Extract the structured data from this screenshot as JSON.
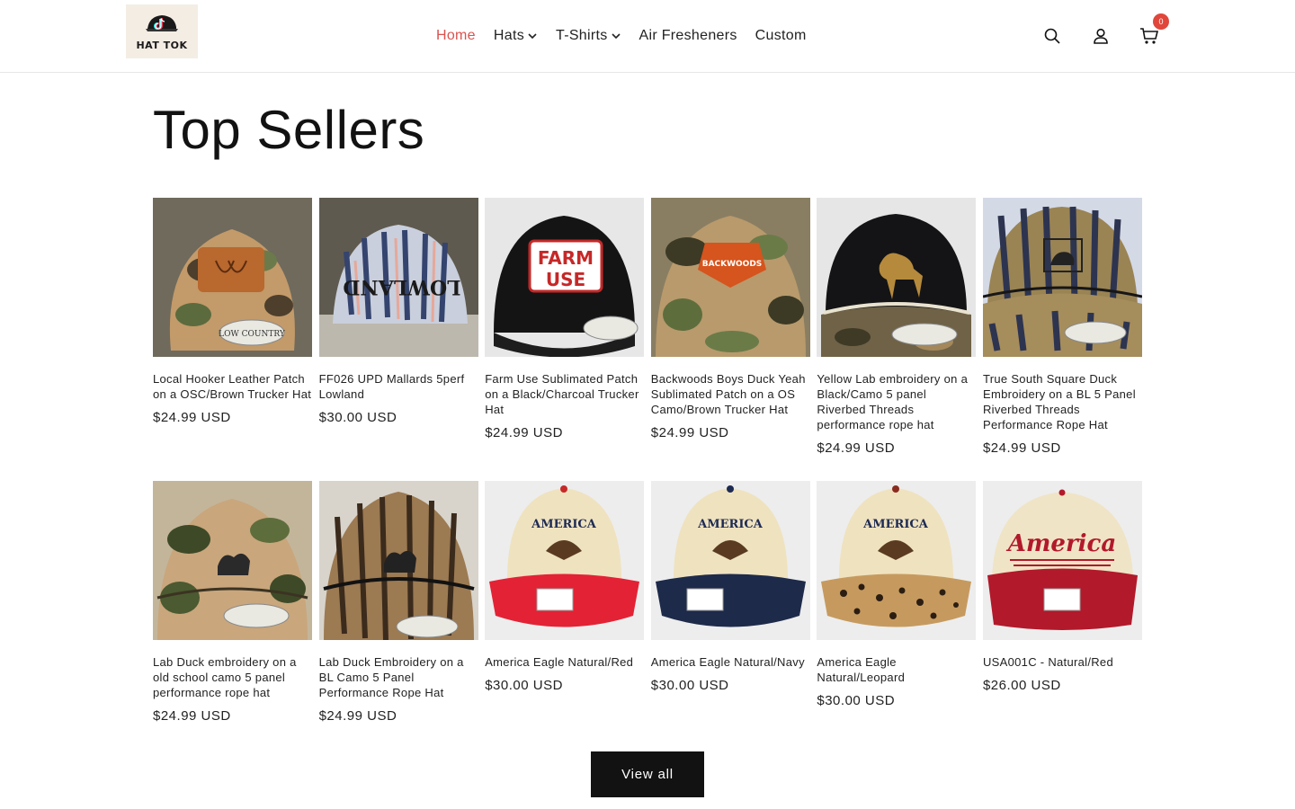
{
  "brand": {
    "name": "HAT TOK"
  },
  "nav": {
    "items": [
      {
        "label": "Home",
        "active": true,
        "dropdown": false
      },
      {
        "label": "Hats",
        "active": false,
        "dropdown": true
      },
      {
        "label": "T-Shirts",
        "active": false,
        "dropdown": true
      },
      {
        "label": "Air Fresheners",
        "active": false,
        "dropdown": false
      },
      {
        "label": "Custom",
        "active": false,
        "dropdown": false
      }
    ]
  },
  "header_icons": {
    "search": "search-icon",
    "account": "account-icon",
    "cart": "cart-icon",
    "cart_count": "0"
  },
  "colors": {
    "accent": "#d9534f",
    "badge": "#e0463a",
    "button": "#121212"
  },
  "section": {
    "title": "Top Sellers",
    "view_all": "View all"
  },
  "products": [
    {
      "title": "Local Hooker Leather Patch on a OSC/Brown Trucker Hat",
      "price": "$24.99 USD",
      "art": "camo-leather"
    },
    {
      "title": "FF026 UPD Mallards 5perf Lowland",
      "price": "$30.00 USD",
      "art": "lowland"
    },
    {
      "title": "Farm Use Sublimated Patch on a Black/Charcoal Trucker Hat",
      "price": "$24.99 USD",
      "art": "farm-use"
    },
    {
      "title": "Backwoods Boys Duck Yeah Sublimated Patch on a OS Camo/Brown Trucker Hat",
      "price": "$24.99 USD",
      "art": "backwoods"
    },
    {
      "title": "Yellow Lab embroidery on a Black/Camo 5 panel Riverbed Threads performance rope hat",
      "price": "$24.99 USD",
      "art": "yellow-lab"
    },
    {
      "title": "True South Square Duck Embroidery on a BL 5 Panel Riverbed Threads Performance Rope Hat",
      "price": "$24.99 USD",
      "art": "true-south"
    },
    {
      "title": "Lab Duck embroidery on a old school camo 5 panel performance rope hat",
      "price": "$24.99 USD",
      "art": "lab-duck-camo"
    },
    {
      "title": "Lab Duck Embroidery on a BL Camo 5 Panel Performance Rope Hat",
      "price": "$24.99 USD",
      "art": "lab-duck-bl"
    },
    {
      "title": "America Eagle Natural/Red",
      "price": "$30.00 USD",
      "art": "eagle-red"
    },
    {
      "title": "America Eagle Natural/Navy",
      "price": "$30.00 USD",
      "art": "eagle-navy"
    },
    {
      "title": "America Eagle Natural/Leopard",
      "price": "$30.00 USD",
      "art": "eagle-leopard"
    },
    {
      "title": "USA001C - Natural/Red",
      "price": "$26.00 USD",
      "art": "america-script"
    }
  ],
  "patch_text": {
    "farm_use": [
      "FARM",
      "USE"
    ],
    "backwoods": "BACKWOODS",
    "lowland": "LOWLAND",
    "america": "AMERICA",
    "america_script": "America",
    "low_country": "LOW COUNTRY"
  }
}
